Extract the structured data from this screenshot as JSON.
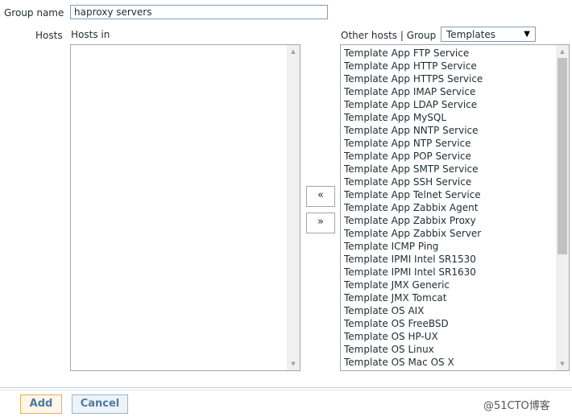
{
  "form": {
    "group_name_label": "Group name",
    "group_name_value": "haproxy servers",
    "hosts_label": "Hosts",
    "hosts_in_label": "Hosts in",
    "other_hosts_label": "Other hosts | Group",
    "group_select_value": "Templates"
  },
  "hosts_in": [],
  "other_hosts": [
    "Template App FTP Service",
    "Template App HTTP Service",
    "Template App HTTPS Service",
    "Template App IMAP Service",
    "Template App LDAP Service",
    "Template App MySQL",
    "Template App NNTP Service",
    "Template App NTP Service",
    "Template App POP Service",
    "Template App SMTP Service",
    "Template App SSH Service",
    "Template App Telnet Service",
    "Template App Zabbix Agent",
    "Template App Zabbix Proxy",
    "Template App Zabbix Server",
    "Template ICMP Ping",
    "Template IPMI Intel SR1530",
    "Template IPMI Intel SR1630",
    "Template JMX Generic",
    "Template JMX Tomcat",
    "Template OS AIX",
    "Template OS FreeBSD",
    "Template OS HP-UX",
    "Template OS Linux",
    "Template OS Mac OS X"
  ],
  "move_left_label": "«",
  "move_right_label": "»",
  "buttons": {
    "add": "Add",
    "cancel": "Cancel"
  },
  "watermark": "@51CTO博客",
  "icons": {
    "scroll_up": "triangle-up",
    "scroll_down": "triangle-down",
    "dropdown": "triangle-down"
  },
  "colors": {
    "divider": "#bfd0dd",
    "button_text": "#4e7aa0",
    "add_border": "#e2b055",
    "cancel_border": "#97b7d0"
  }
}
